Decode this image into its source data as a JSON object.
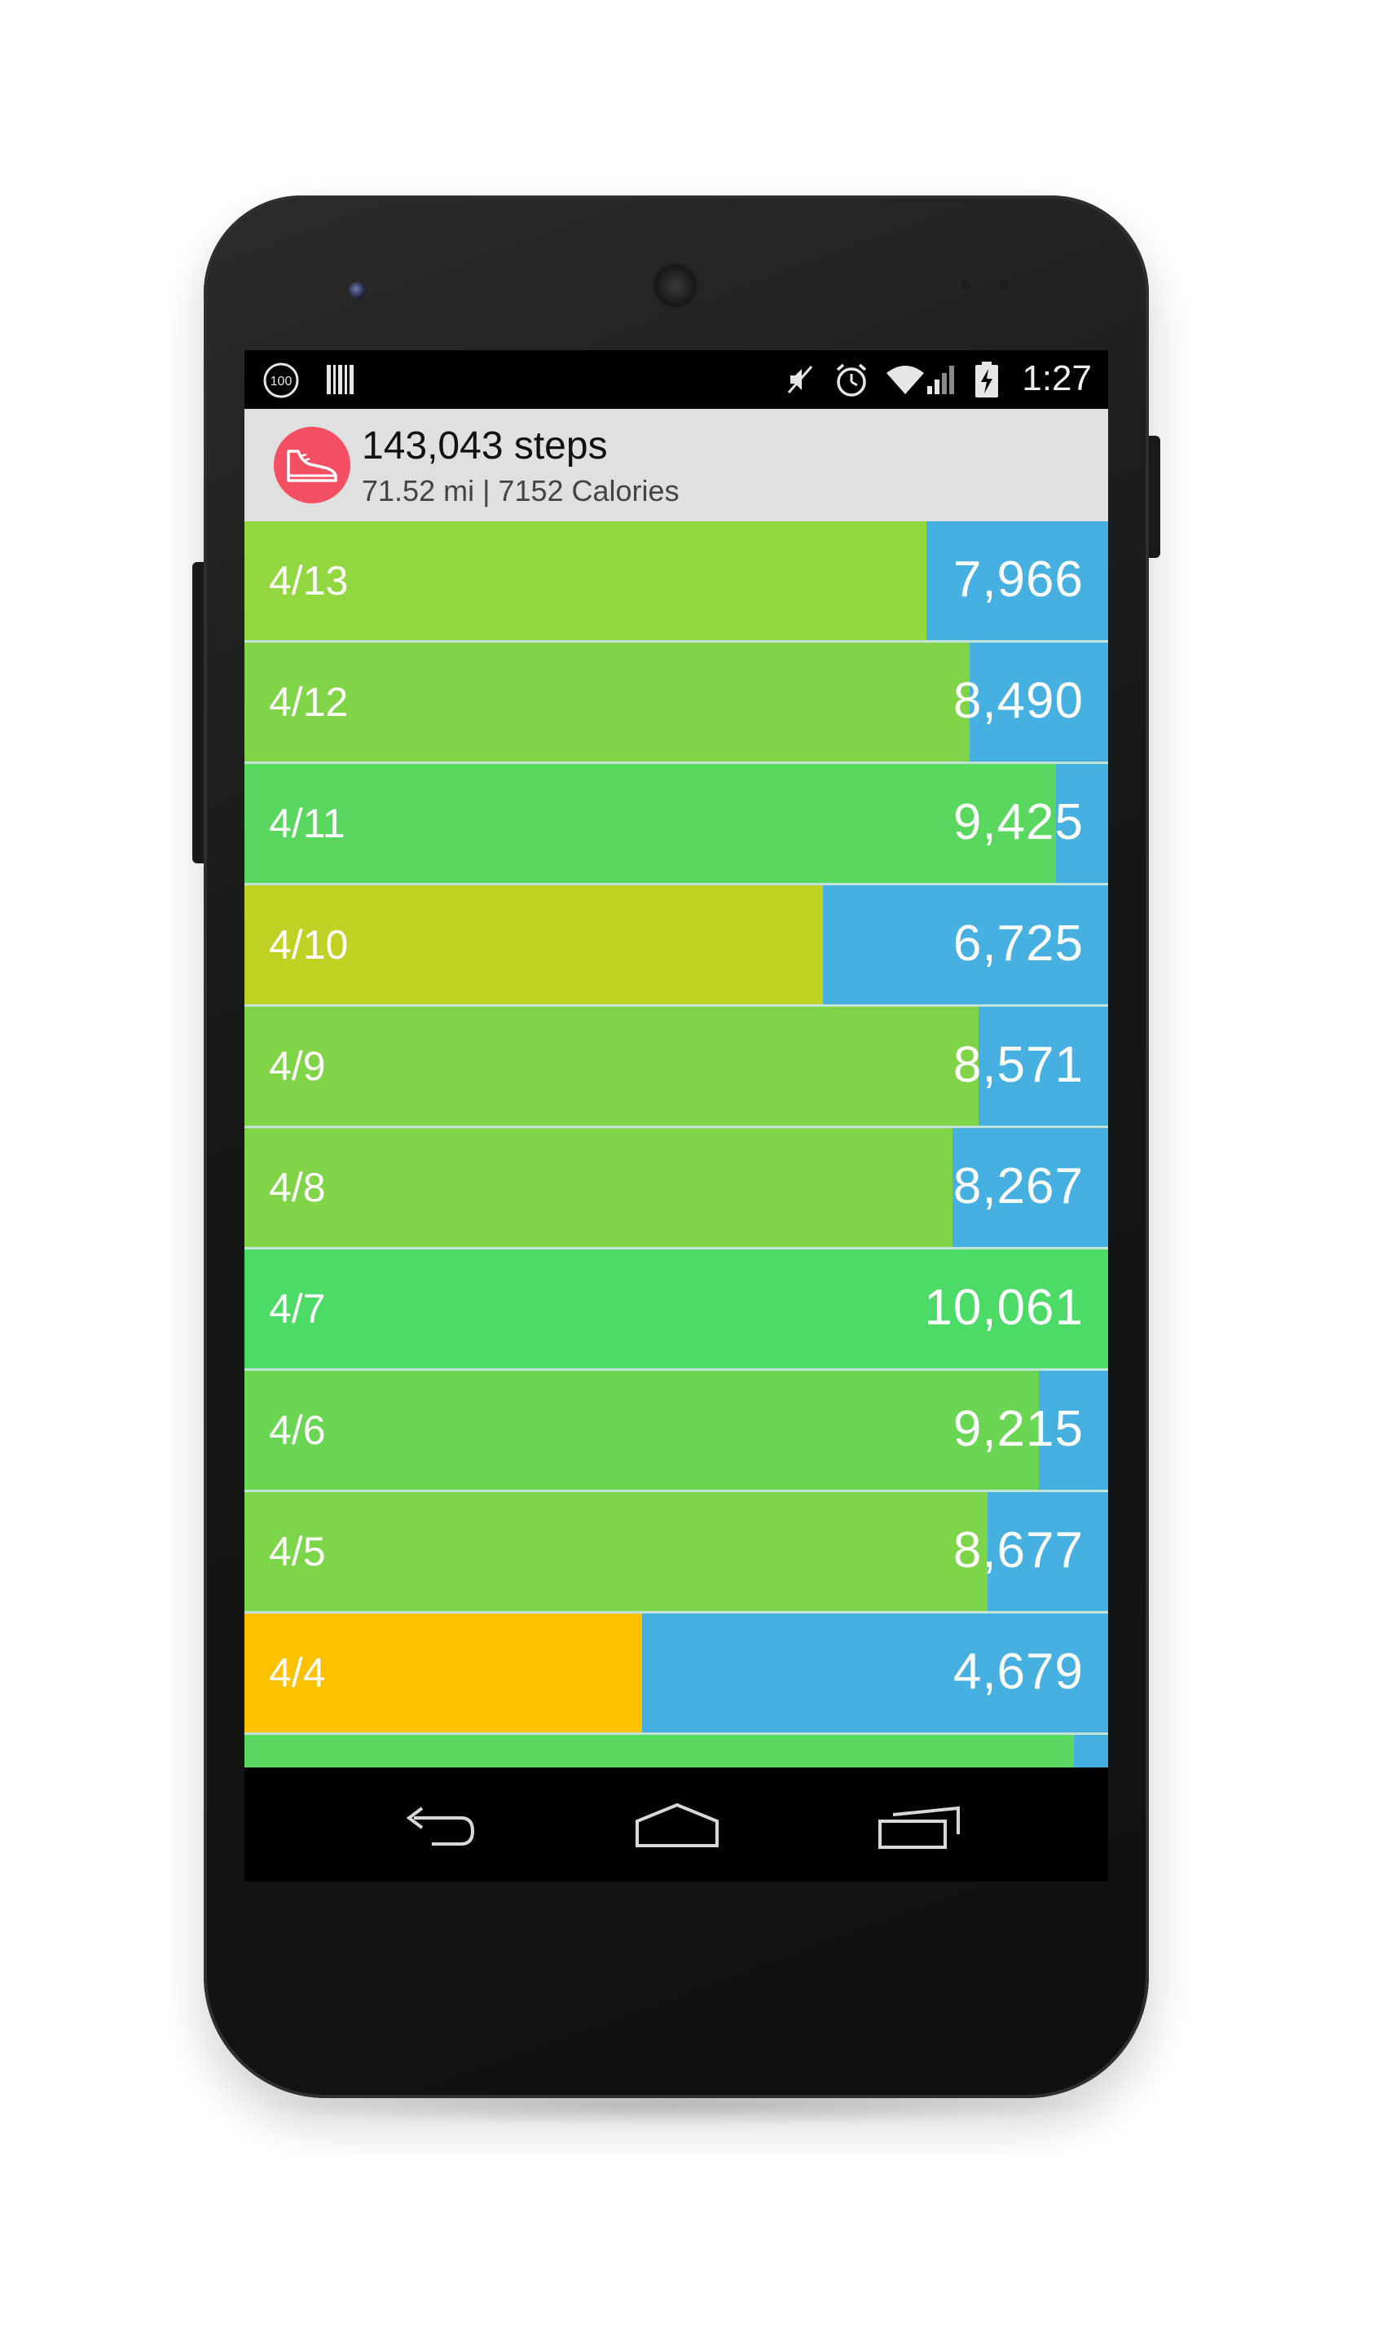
{
  "status_bar": {
    "time": "1:27",
    "badge_text": "100",
    "icons": [
      "battery-100-notification-icon",
      "barcode-icon",
      "vibrate-mute-icon",
      "alarm-clock-icon",
      "wifi-icon",
      "cell-signal-icon",
      "battery-charging-icon"
    ]
  },
  "header": {
    "title": "143,043 steps",
    "subtitle": "71.52 mi | 7152 Calories",
    "avatar_icon": "sneaker-icon",
    "avatar_color": "#f44f63"
  },
  "rows": [
    {
      "date": "4/13",
      "steps": "7,966",
      "progress": 0.79,
      "color": "#93d740"
    },
    {
      "date": "4/12",
      "steps": "8,490",
      "progress": 0.84,
      "color": "#81d447"
    },
    {
      "date": "4/11",
      "steps": "9,425",
      "progress": 0.94,
      "color": "#5ad75f"
    },
    {
      "date": "4/10",
      "steps": "6,725",
      "progress": 0.67,
      "color": "#bfd223"
    },
    {
      "date": "4/9",
      "steps": "8,571",
      "progress": 0.85,
      "color": "#81d447"
    },
    {
      "date": "4/8",
      "steps": "8,267",
      "progress": 0.82,
      "color": "#81d447"
    },
    {
      "date": "4/7",
      "steps": "10,061",
      "progress": 1.0,
      "color": "#4bdb66"
    },
    {
      "date": "4/6",
      "steps": "9,215",
      "progress": 0.92,
      "color": "#6ad654"
    },
    {
      "date": "4/5",
      "steps": "8,677",
      "progress": 0.86,
      "color": "#7dd54a"
    },
    {
      "date": "4/4",
      "steps": "4,679",
      "progress": 0.46,
      "color": "#fdc100"
    },
    {
      "date": "",
      "steps": "",
      "progress": 0.96,
      "color": "#5ad75f"
    }
  ],
  "colors": {
    "remaining": "#46b1e1",
    "header_bg": "#e0e0e0"
  },
  "nav": {
    "back_icon": "back-arrow-icon",
    "home_icon": "home-icon",
    "recents_icon": "recent-apps-icon"
  }
}
